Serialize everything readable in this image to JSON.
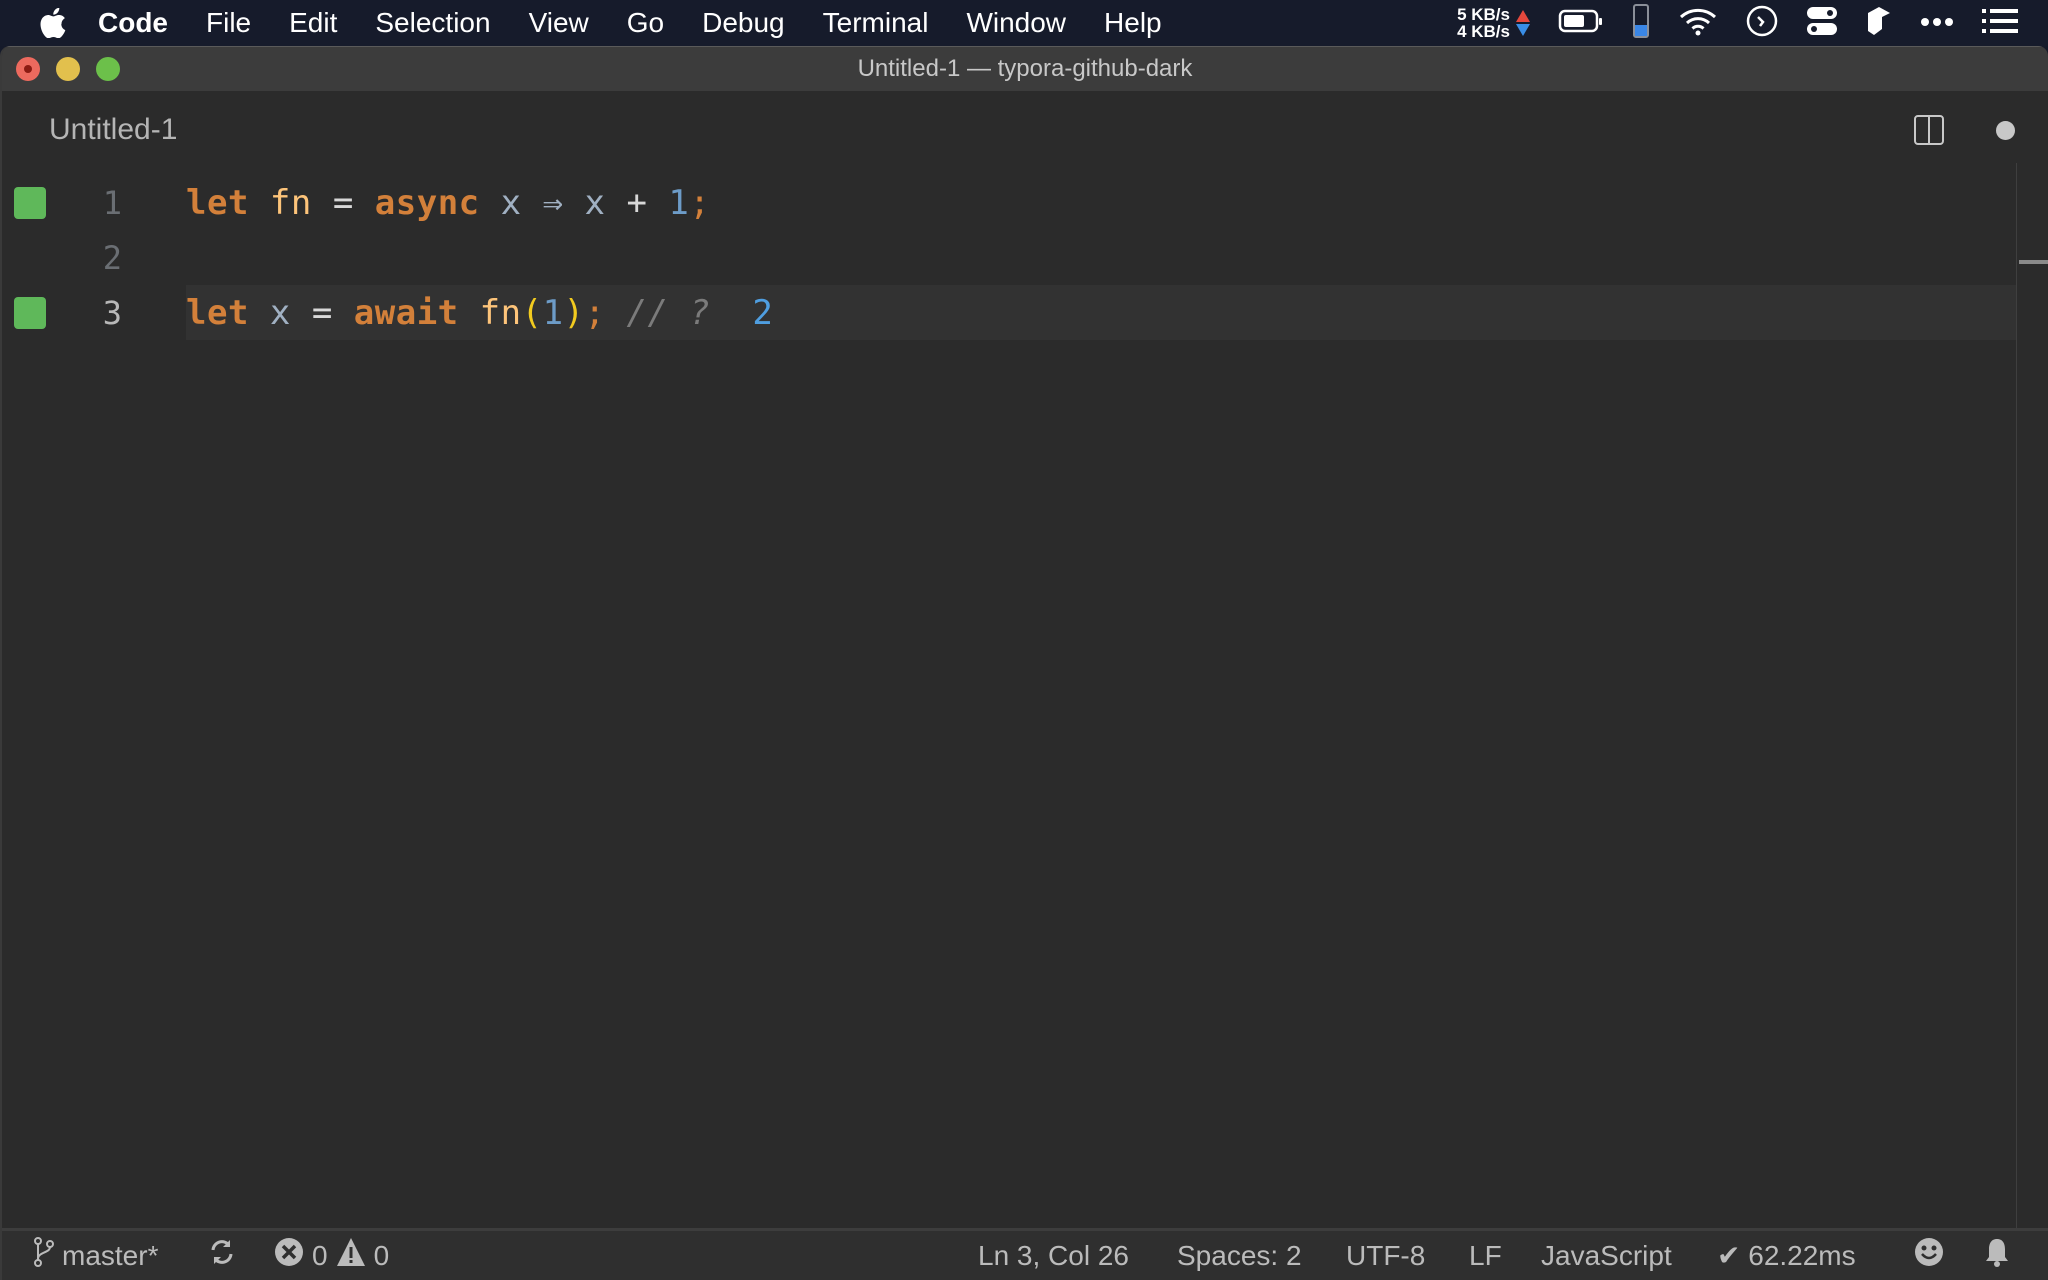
{
  "menubar": {
    "apple_icon": "apple-logo",
    "items": [
      "Code",
      "File",
      "Edit",
      "Selection",
      "View",
      "Go",
      "Debug",
      "Terminal",
      "Window",
      "Help"
    ],
    "network": {
      "upload": "5 KB/s",
      "download": "4 KB/s"
    },
    "status_icons": [
      "battery-icon",
      "phone-icon",
      "wifi-icon",
      "clock-icon",
      "toggle-icon",
      "box-icon",
      "more-icon",
      "list-icon"
    ]
  },
  "window": {
    "title": "Untitled-1 — typora-github-dark",
    "tab_label": "Untitled-1",
    "editor": {
      "lines": [
        {
          "number": "1",
          "modified": true,
          "tokens": [
            {
              "t": "let",
              "c": "kw"
            },
            {
              "t": " ",
              "c": ""
            },
            {
              "t": "fn",
              "c": "fnname"
            },
            {
              "t": " = ",
              "c": "op"
            },
            {
              "t": "async",
              "c": "kw"
            },
            {
              "t": " x ",
              "c": "ident"
            },
            {
              "t": "⇒",
              "c": "ident"
            },
            {
              "t": " x ",
              "c": "ident"
            },
            {
              "t": "+ ",
              "c": "op"
            },
            {
              "t": "1",
              "c": "num"
            },
            {
              "t": ";",
              "c": "semi"
            }
          ]
        },
        {
          "number": "2",
          "modified": false,
          "tokens": []
        },
        {
          "number": "3",
          "modified": true,
          "current": true,
          "tokens": [
            {
              "t": "let",
              "c": "kw"
            },
            {
              "t": " x",
              "c": "ident"
            },
            {
              "t": " = ",
              "c": "op"
            },
            {
              "t": "await",
              "c": "kw"
            },
            {
              "t": " fn",
              "c": "fnname"
            },
            {
              "t": "(",
              "c": "paren"
            },
            {
              "t": "1",
              "c": "num"
            },
            {
              "t": ")",
              "c": "paren"
            },
            {
              "t": ";",
              "c": "semi"
            },
            {
              "t": " // ?",
              "c": "comment"
            },
            {
              "t": "  2",
              "c": "result"
            }
          ]
        }
      ]
    }
  },
  "statusbar": {
    "branch": "master*",
    "errors": "0",
    "warnings": "0",
    "position": "Ln 3, Col 26",
    "spaces": "Spaces: 2",
    "encoding": "UTF-8",
    "eol": "LF",
    "language": "JavaScript",
    "timing": "✔ 62.22ms"
  },
  "colors": {
    "keyword": "#d3803a",
    "function": "#fdc47a",
    "number": "#6d9cc8",
    "result": "#4f9ee0",
    "gutter_modified": "#5fb85a"
  }
}
